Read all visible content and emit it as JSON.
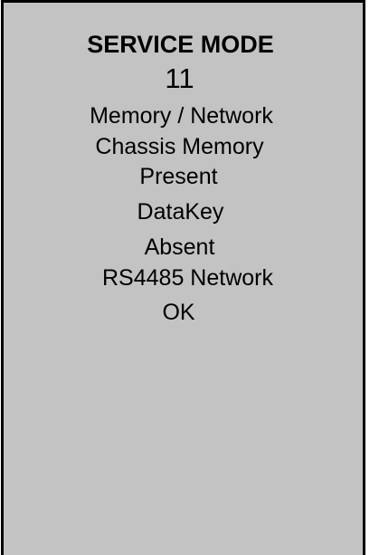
{
  "screen": {
    "title": "SERVICE MODE",
    "mode_number": "11",
    "lines": [
      "Memory / Network",
      "Chassis Memory",
      "Present",
      "DataKey",
      "Absent",
      "RS4485 Network",
      "OK"
    ]
  },
  "colors": {
    "display_background": "#c3c3c3",
    "text": "#000000",
    "bezel": "#000000"
  }
}
